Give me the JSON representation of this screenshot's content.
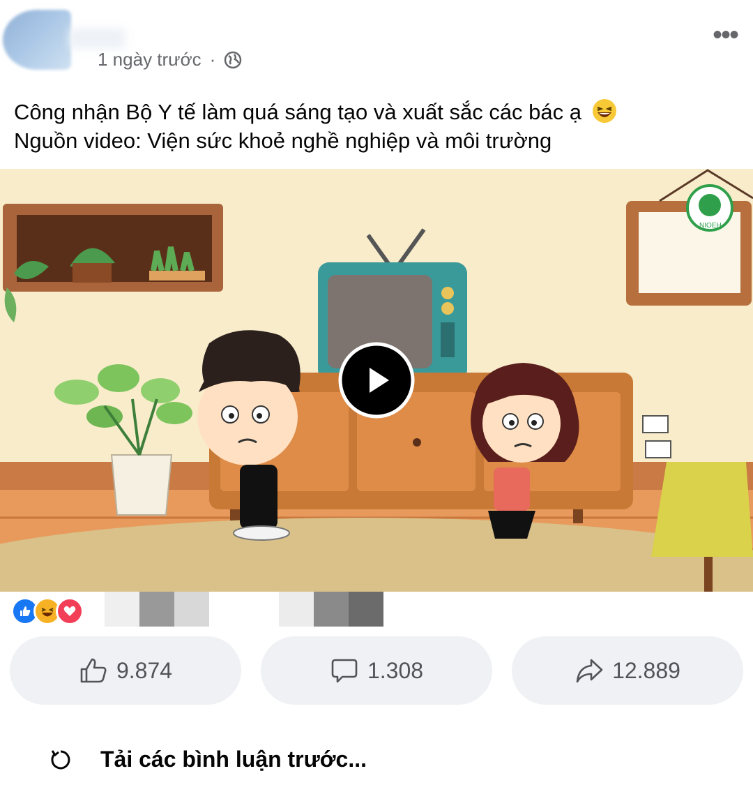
{
  "post": {
    "time_text": "1 ngày trước",
    "separator": "·",
    "privacy_icon": "globe-icon",
    "more_icon": "more-horizontal-icon",
    "caption_line1": "Công nhận Bộ Y tế làm quá sáng tạo và xuất sắc các bác ạ",
    "caption_emoji": "laughing-face-emoji",
    "caption_line2": "Nguồn video: Viện sức khoẻ nghề nghiệp và môi trường"
  },
  "video": {
    "watermark_text": "NIOEH",
    "play_icon": "play-icon"
  },
  "reactions": {
    "icons": [
      "like-icon",
      "haha-icon",
      "love-icon"
    ],
    "colors": {
      "like": "#1877f2",
      "haha": "#f7b125",
      "love": "#f33e58"
    }
  },
  "actions": {
    "like_count": "9.874",
    "comment_count": "1.308",
    "share_count": "12.889"
  },
  "comments": {
    "load_previous_label": "Tải các bình luận trước...",
    "load_icon": "refresh-icon"
  },
  "colors": {
    "secondary_text": "#65676b",
    "button_bg": "#eff1f4",
    "tv": "#3a9a9a",
    "wall": "#f8eccb"
  }
}
